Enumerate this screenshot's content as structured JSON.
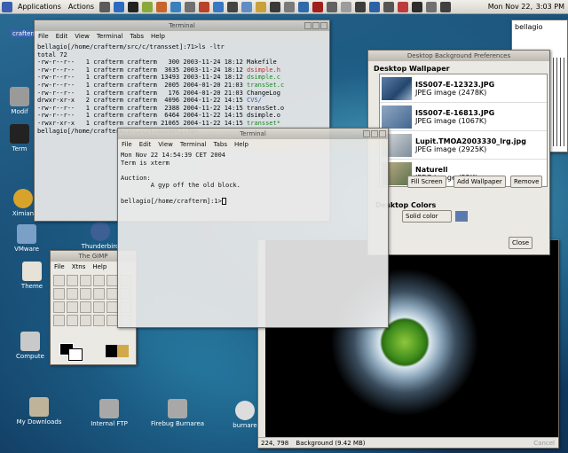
{
  "panel": {
    "applications_label": "Applications",
    "actions_label": "Actions",
    "date": "Mon Nov 22,",
    "time": "3:03 PM"
  },
  "desktop_icons": [
    {
      "label": "crafterm"
    },
    {
      "label": "Modif"
    },
    {
      "label": "Term"
    },
    {
      "label": "Ximian"
    },
    {
      "label": "VMware"
    },
    {
      "label": "Thunderbird Client"
    },
    {
      "label": "Theme"
    },
    {
      "label": "Compute"
    },
    {
      "label": "My Downloads"
    },
    {
      "label": "Internal FTP"
    },
    {
      "label": "Firebug Burnarea"
    },
    {
      "label": "burnare"
    }
  ],
  "term1": {
    "title": "Terminal",
    "menu": [
      "File",
      "Edit",
      "View",
      "Terminal",
      "Tabs",
      "Help"
    ],
    "lines": [
      {
        "text": "bellagio[/home/crafterm/src/c/transset]:71>ls -ltr"
      },
      {
        "text": "total 72"
      },
      {
        "text": "-rw-r--r--   1 crafterm crafterm   300 2003-11-24 18:12 Makefile"
      },
      {
        "text": "-rw-r--r--   1 crafterm crafterm  3635 2003-11-24 18:12 ",
        "hl": "dsimple.h",
        "cls": "red"
      },
      {
        "text": "-rw-r--r--   1 crafterm crafterm 13493 2003-11-24 18:12 ",
        "hl": "dsimple.c",
        "cls": "green"
      },
      {
        "text": "-rw-r--r--   1 crafterm crafterm  2005 2004-01-20 21:03 ",
        "hl": "transSet.c",
        "cls": "green"
      },
      {
        "text": "-rw-r--r--   1 crafterm crafterm   176 2004-01-20 21:03 ChangeLog"
      },
      {
        "text": "drwxr-xr-x   2 crafterm crafterm  4096 2004-11-22 14:15 ",
        "hl": "CVS/",
        "cls": "blue"
      },
      {
        "text": "-rw-r--r--   1 crafterm crafterm  2388 2004-11-22 14:15 transSet.o"
      },
      {
        "text": "-rw-r--r--   1 crafterm crafterm  6464 2004-11-22 14:15 dsimple.o"
      },
      {
        "text": "-rwxr-xr-x   1 crafterm crafterm 21065 2004-11-22 14:15 ",
        "hl": "transset*",
        "cls": "green"
      },
      {
        "text": "bellagio[/home/crafterm/src/c/transset]:72>"
      }
    ]
  },
  "term2": {
    "title": "Terminal",
    "menu": [
      "File",
      "Edit",
      "View",
      "Terminal",
      "Tabs",
      "Help"
    ],
    "lines": [
      "Mon Nov 22 14:54:39 CET 2004",
      "Term is xterm",
      "",
      "Auction:",
      "        A gyp off the old block.",
      "",
      "bellagio[/home/crafterm]:1>"
    ]
  },
  "wallpaper": {
    "title": "Desktop Background Preferences",
    "section": "Desktop Wallpaper",
    "items": [
      {
        "name": "ISS007-E-12323.JPG",
        "info": "JPEG image (2478K)"
      },
      {
        "name": "ISS007-E-16813.JPG",
        "info": "JPEG image (1067K)"
      },
      {
        "name": "Lupit.TMOA2003330_lrg.jpg",
        "info": "JPEG image (2925K)"
      },
      {
        "name": "Naturell",
        "info": "JPEG image (55K)"
      }
    ],
    "style_value": "Fill Screen",
    "add_button": "Add Wallpaper",
    "remove_button": "Remove",
    "colors_label": "Desktop Colors",
    "color_mode": "Solid color",
    "close_button": "Close"
  },
  "gimp": {
    "title": "The GIMP",
    "menu": [
      "File",
      "Xtns",
      "Help"
    ]
  },
  "image_win": {
    "status_coords": "224, 798",
    "status_text": "Background (9.42 MB)",
    "cancel": "Cancel"
  },
  "bellagio_label": "bellagio"
}
